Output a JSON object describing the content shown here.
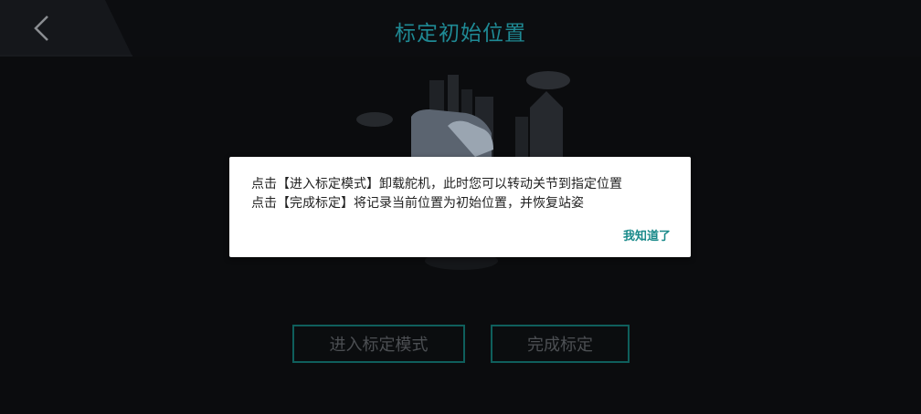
{
  "header": {
    "title": "标定初始位置",
    "back_icon": "chevron-left-icon"
  },
  "illustration": {
    "icon": "robot-joint-illustration"
  },
  "buttons": {
    "enter_mode": "进入标定模式",
    "finish": "完成标定"
  },
  "dialog": {
    "line1": "点击【进入标定模式】卸载舵机，此时您可以转动关节到指定位置",
    "line2": "点击【完成标定】将记录当前位置为初始位置，并恢复站姿",
    "ok": "我知道了"
  },
  "colors": {
    "accent": "#1f8a95",
    "button_border": "#0f5f5c",
    "dialog_ok": "#1a8a8a",
    "background": "#0b0c0e"
  }
}
